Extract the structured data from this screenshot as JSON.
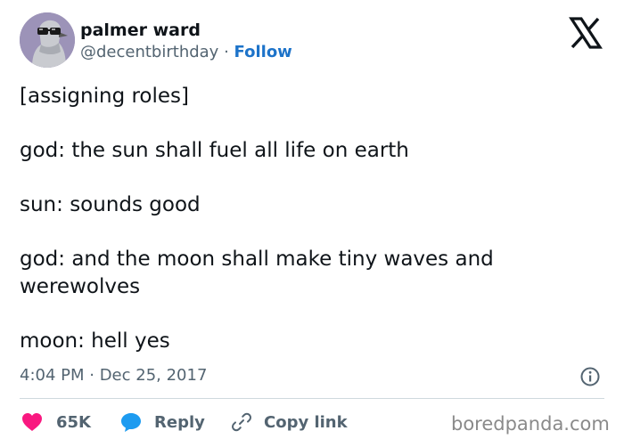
{
  "author": {
    "name": "palmer ward",
    "handle": "@decentbirthday",
    "separator": "·",
    "follow_label": "Follow"
  },
  "tweet": {
    "lines": [
      "[assigning roles]",
      "god: the sun shall fuel all life on earth",
      "sun: sounds good",
      "god: and the moon shall make tiny waves and werewolves",
      "moon: hell yes"
    ],
    "timestamp": "4:04 PM · Dec 25, 2017"
  },
  "actions": {
    "like_count": "65K",
    "reply_label": "Reply",
    "copy_label": "Copy link"
  },
  "watermark": "boredpanda.com",
  "icons": [
    "avatar",
    "x-logo-icon",
    "info-icon",
    "heart-icon",
    "reply-bubble-icon",
    "link-icon"
  ],
  "colors": {
    "text": "#0f1419",
    "muted": "#536471",
    "follow": "#1d73c9",
    "like": "#f91880",
    "reply": "#1d9bf0",
    "divider": "#cfd9de"
  }
}
